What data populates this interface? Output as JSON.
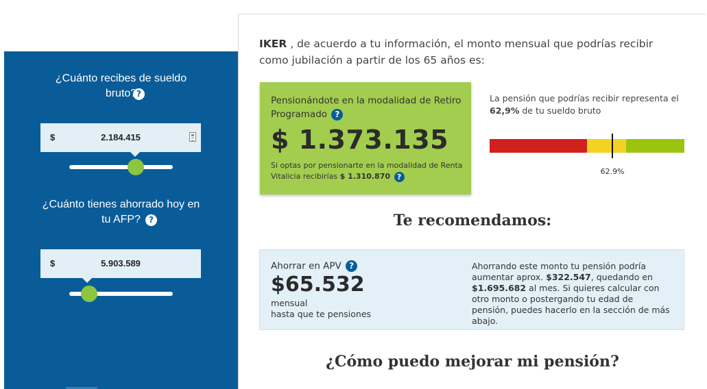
{
  "left": {
    "q1_text": "¿Cuánto recibes de sueldo bruto?",
    "q1_help": "?",
    "salary": {
      "currency": "$",
      "value": "2.184.415"
    },
    "salary_slider_level": 0.64,
    "q2_text": "¿Cuánto tienes ahorrado hoy en tu AFP?",
    "q2_help": "?",
    "savings": {
      "currency": "$",
      "value": "5.903.589"
    },
    "savings_slider_level": 0.19
  },
  "intro": {
    "name": "IKER",
    "text": " , de acuerdo a tu información, el monto mensual que podrías recibir como jubilación a partir de los 65 años es:"
  },
  "pension": {
    "title": "Pensionándote en la modalidad de Retiro Programado",
    "help": "?",
    "amount": "$ 1.373.135",
    "note": "Si optas por pensionarte en la modalidad de Renta Vitalicia recibirías",
    "note_amount": "$ 1.310.870",
    "note_help": "?"
  },
  "ratio": {
    "text_before": "La pensión que podrías recibir representa el ",
    "percent": "62,9%",
    "text_after": " de tu sueldo bruto",
    "marker_label": "62.9%",
    "marker_fraction": 0.629,
    "segments": [
      {
        "color": "#d0211c",
        "fraction": 0.5
      },
      {
        "color": "#f2d324",
        "fraction": 0.2
      },
      {
        "color": "#9bc40f",
        "fraction": 0.3
      }
    ]
  },
  "recommend": {
    "heading": "Te recomendamos:",
    "title": "Ahorrar en APV",
    "help": "?",
    "amount": "$65.532",
    "sub1": "mensual",
    "sub2": "hasta que te pensiones",
    "desc_1": "Ahorrando este monto tu pensión podría aumentar aprox. ",
    "desc_b1": "$322.547",
    "desc_2": ", quedando en ",
    "desc_b2": "$1.695.682",
    "desc_3": " al mes. Si quieres calcular con otro monto o postergando tu edad de pensión, puedes hacerlo en la sección de más abajo."
  },
  "improve_heading": "¿Cómo puedo mejorar mi pensión?",
  "colors": {
    "panel_blue": "#0a5c99",
    "slider_thumb": "#8cc63f",
    "pension_green": "#a3cd4e",
    "rec_bg": "#e3f0f8"
  }
}
